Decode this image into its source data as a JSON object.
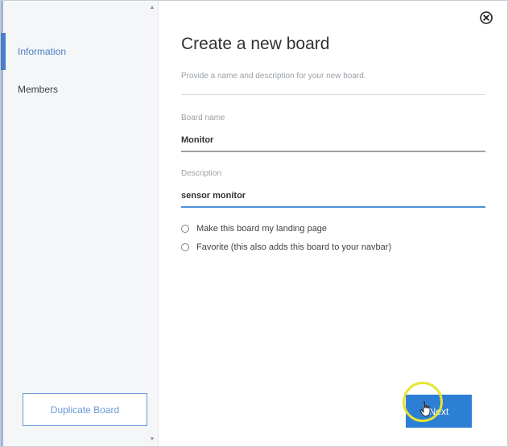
{
  "sidebar": {
    "items": [
      {
        "label": "Information",
        "active": true
      },
      {
        "label": "Members",
        "active": false
      }
    ],
    "duplicate_button": "Duplicate Board"
  },
  "dialog": {
    "title": "Create a new board",
    "subtitle": "Provide a name and description for your new board.",
    "fields": {
      "board_name": {
        "label": "Board name",
        "value": "Monitor"
      },
      "description": {
        "label": "Description",
        "value": "sensor monitor"
      }
    },
    "options": [
      {
        "label": "Make this board my landing page",
        "checked": false
      },
      {
        "label": "Favorite (this also adds this board to your navbar)",
        "checked": false
      }
    ],
    "next_button": "Next"
  },
  "icons": {
    "close": "close-circle-icon",
    "scroll_up": "chevron-up-icon",
    "scroll_down": "chevron-down-icon",
    "cursor": "hand-pointer-icon"
  },
  "colors": {
    "accent": "#4a7ec9",
    "primary_button": "#2c7fd4",
    "active_field_underline": "#4a90d9",
    "field_underline": "#9aa0a6",
    "cursor_highlight": "#e6e630"
  }
}
